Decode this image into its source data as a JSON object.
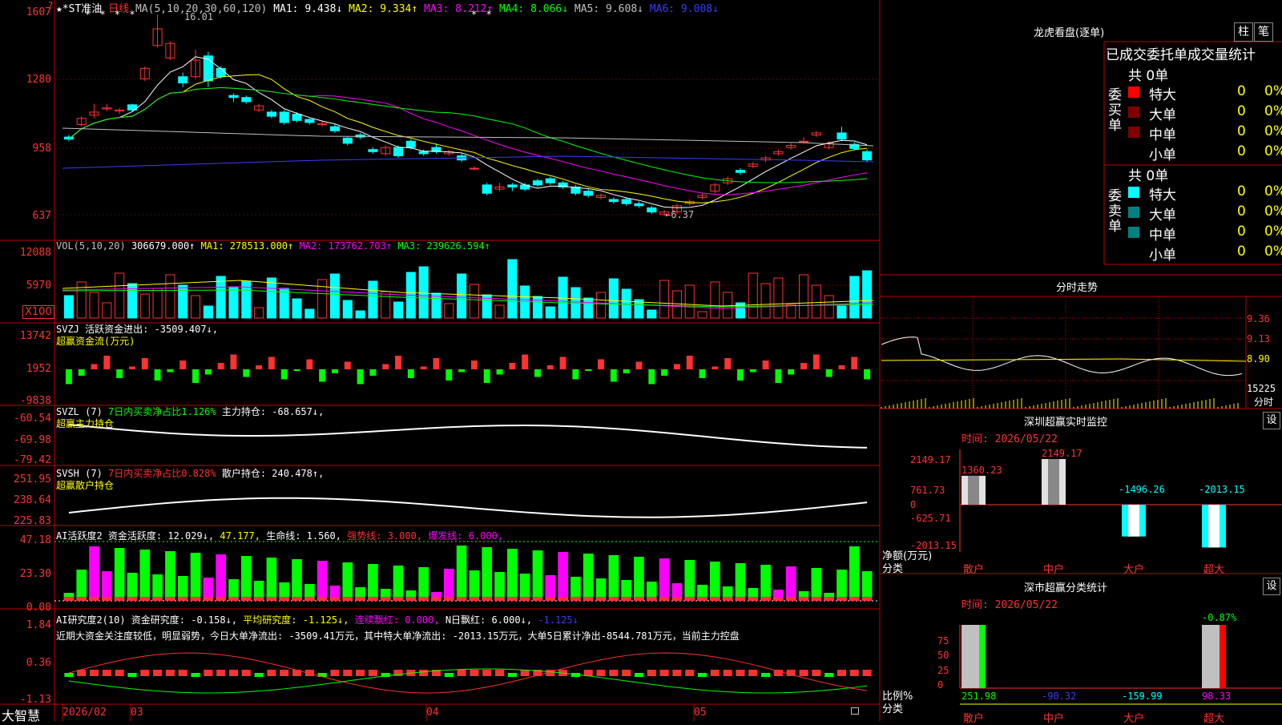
{
  "app": {
    "brand": "大智慧"
  },
  "colors": {
    "up": "#ff3232",
    "down": "#00ffff",
    "bg": "#000000",
    "grid": "#c00000",
    "white": "#ffffff",
    "yellow": "#ffff00",
    "magenta": "#ff00ff",
    "green": "#00ff00",
    "blue": "#3c3cff",
    "gray": "#c0c0c0",
    "darkred": "#800000",
    "teal": "#008080"
  },
  "header": {
    "flag": "?",
    "name": "★*ST准油",
    "period": "日线",
    "ma_label": "MA(5,10,20,30,60,120)",
    "ma1": "MA1: 9.438↓",
    "ma2": "MA2: 9.334↑",
    "ma3": "MA3: 8.212↑",
    "ma4": "MA4: 8.066↓",
    "ma5": "MA5: 9.608↓",
    "ma6": "MA6: 9.008↓",
    "high_mark": "16.01",
    "low_mark": "←6.37",
    "stars_left": "* *  * *",
    "stars_right": "* *"
  },
  "main_axis": [
    "1607",
    "1280",
    "958",
    "637"
  ],
  "vol": {
    "label": "VOL(5,10,20)",
    "value": "306679.000↑",
    "ma1": "MA1: 278513.000↑",
    "ma2": "MA2: 173762.703↑",
    "ma3": "MA3: 239626.594↑",
    "axis": [
      "12088",
      "5970",
      "X100"
    ]
  },
  "svzj": {
    "label": "SVZJ  活跃资金进出: -3509.407↓,",
    "sub": "超赢资金流(万元)",
    "axis": [
      "13742",
      "1952",
      "-9838"
    ]
  },
  "svzl": {
    "label": "SVZL (7)",
    "pct": "7日内买卖净占比1.126%",
    "holding": "主力持仓: -68.657↓,",
    "sub": "超赢主力持仓",
    "axis": [
      "-60.54",
      "-69.98",
      "-79.42"
    ]
  },
  "svsh": {
    "label": "SVSH (7)",
    "pct": "7日内买卖净占比0.828%",
    "holding": "散户持仓: 240.478↑,",
    "sub": "超赢散户持仓",
    "axis": [
      "251.95",
      "238.64",
      "225.83"
    ]
  },
  "ai2": {
    "label": "AI活跃度2 资金活跃度: 12.029↓,",
    "v2": "47.177,",
    "life": "生命线: 1.560,",
    "strong": "强势线: 3.000,",
    "burst": "爆发线: 6.000,",
    "axis": [
      "47.18",
      "23.30",
      "0.00"
    ]
  },
  "ai_research": {
    "label": "AI研究度2(10) 资金研究度: -0.158↓,",
    "avg": "平均研究度: -1.125↓,",
    "red": "连续飘红: 0.000,",
    "nred": "N日飘红: 6.000↓,",
    "last": "-1.125↓",
    "note": "近期大资金关注度较低，明显弱势，今日大单净流出: -3509.41万元，其中特大单净流出: -2013.15万元，大单5日累计净出-8544.781万元，当前主力控盘",
    "axis": [
      "1.84",
      "0.36",
      "-1.13"
    ]
  },
  "xaxis": [
    "2026/02",
    "03",
    "04",
    "05"
  ],
  "dragon": {
    "title": "龙虎看盘(逐单)",
    "btn1": "柱",
    "btn2": "笔",
    "head": "已成交委托单成交量统计",
    "buy_label": "委买单",
    "sell_label": "委卖单",
    "buy_total": "共 0单",
    "sell_total": "共 0单",
    "buy_rows": [
      {
        "name": "特大",
        "count": "0",
        "pct": "0%"
      },
      {
        "name": "大单",
        "count": "0",
        "pct": "0%"
      },
      {
        "name": "中单",
        "count": "0",
        "pct": "0%"
      },
      {
        "name": "小单",
        "count": "0",
        "pct": "0%"
      }
    ],
    "sell_rows": [
      {
        "name": "特大",
        "count": "0",
        "pct": "0%"
      },
      {
        "name": "大单",
        "count": "0",
        "pct": "0%"
      },
      {
        "name": "中单",
        "count": "0",
        "pct": "0%"
      },
      {
        "name": "小单",
        "count": "0",
        "pct": "0%"
      }
    ]
  },
  "intraday": {
    "title": "分时走势",
    "axis": [
      "9.36",
      "9.13",
      "8.90",
      "15225"
    ],
    "unit": "分时"
  },
  "monitor": {
    "title": "深圳超赢实时监控",
    "btn": "设",
    "time": "时间: 2026/05/22",
    "axis": [
      "2149.17",
      "761.73",
      "0",
      "-625.71",
      "-2013.15"
    ],
    "ylabel": "净额(万元)",
    "xlabel": "分类",
    "cats": [
      "散户",
      "中户",
      "大户",
      "超大"
    ],
    "values": [
      1360.23,
      2149.17,
      -1496.26,
      -2013.15
    ],
    "labels": [
      "1360.23",
      "2149.17",
      "-1496.26",
      "-2013.15"
    ]
  },
  "classify": {
    "title": "深市超赢分类统计",
    "btn": "设",
    "time": "时间: 2026/05/22",
    "axis": [
      "75",
      "50",
      "25",
      "0"
    ],
    "ylabel": "比例%",
    "xlabel": "分类",
    "top_label": "-0.87%",
    "cats": [
      "散户",
      "中户",
      "大户",
      "超大"
    ],
    "labels": [
      "251.98",
      "-90.32",
      "-159.99",
      "98.33"
    ]
  },
  "chart_data": {
    "type": "candlestick",
    "price_axis": [
      1607,
      1280,
      958,
      637
    ],
    "candles": [
      [
        1010,
        1000,
        1020,
        990
      ],
      [
        1070,
        1100,
        1110,
        1060
      ],
      [
        1115,
        1130,
        1170,
        1100
      ],
      [
        1145,
        1150,
        1170,
        1135
      ],
      [
        1135,
        1140,
        1150,
        1120
      ],
      [
        1165,
        1140,
        1170,
        1130
      ],
      [
        1290,
        1340,
        1350,
        1280
      ],
      [
        1450,
        1530,
        1600,
        1440
      ],
      [
        1390,
        1460,
        1470,
        1380
      ],
      [
        1300,
        1270,
        1320,
        1250
      ],
      [
        1300,
        1380,
        1430,
        1290
      ],
      [
        1400,
        1280,
        1420,
        1250
      ],
      [
        1340,
        1300,
        1350,
        1290
      ],
      [
        1210,
        1200,
        1220,
        1180
      ],
      [
        1200,
        1180,
        1210,
        1170
      ],
      [
        1140,
        1160,
        1170,
        1130
      ],
      [
        1130,
        1110,
        1140,
        1100
      ],
      [
        1130,
        1080,
        1140,
        1070
      ],
      [
        1120,
        1090,
        1130,
        1080
      ],
      [
        1095,
        1080,
        1100,
        1070
      ],
      [
        1070,
        1075,
        1090,
        1060
      ],
      [
        1060,
        1040,
        1070,
        1030
      ],
      [
        1005,
        980,
        1010,
        970
      ],
      [
        1020,
        1010,
        1030,
        1000
      ],
      [
        950,
        940,
        960,
        930
      ],
      [
        930,
        960,
        970,
        920
      ],
      [
        960,
        920,
        970,
        910
      ],
      [
        990,
        960,
        1000,
        950
      ],
      [
        940,
        930,
        950,
        920
      ],
      [
        960,
        940,
        980,
        930
      ],
      [
        930,
        940,
        950,
        920
      ],
      [
        920,
        900,
        930,
        890
      ],
      [
        860,
        860,
        870,
        850
      ],
      [
        780,
        740,
        790,
        730
      ],
      [
        760,
        770,
        790,
        750
      ],
      [
        780,
        770,
        790,
        750
      ],
      [
        780,
        760,
        790,
        750
      ],
      [
        800,
        780,
        810,
        770
      ],
      [
        810,
        790,
        820,
        780
      ],
      [
        790,
        770,
        800,
        760
      ],
      [
        770,
        740,
        780,
        730
      ],
      [
        750,
        730,
        760,
        720
      ],
      [
        720,
        730,
        740,
        710
      ],
      [
        710,
        700,
        720,
        690
      ],
      [
        710,
        690,
        720,
        680
      ],
      [
        690,
        680,
        700,
        670
      ],
      [
        670,
        650,
        680,
        640
      ],
      [
        640,
        650,
        660,
        630
      ],
      [
        650,
        680,
        690,
        640
      ],
      [
        690,
        700,
        710,
        680
      ],
      [
        720,
        730,
        740,
        710
      ],
      [
        750,
        780,
        790,
        740
      ],
      [
        790,
        810,
        820,
        780
      ],
      [
        850,
        840,
        860,
        830
      ],
      [
        870,
        880,
        890,
        860
      ],
      [
        900,
        910,
        920,
        890
      ],
      [
        930,
        940,
        950,
        920
      ],
      [
        960,
        970,
        980,
        950
      ],
      [
        990,
        990,
        1010,
        980
      ],
      [
        1020,
        1030,
        1040,
        1010
      ],
      [
        960,
        980,
        990,
        950
      ],
      [
        1030,
        1000,
        1060,
        990
      ],
      [
        975,
        955,
        985,
        945
      ],
      [
        940,
        900,
        950,
        890
      ]
    ],
    "xlabels": [
      "2026/02",
      "03",
      "04",
      "05"
    ]
  }
}
